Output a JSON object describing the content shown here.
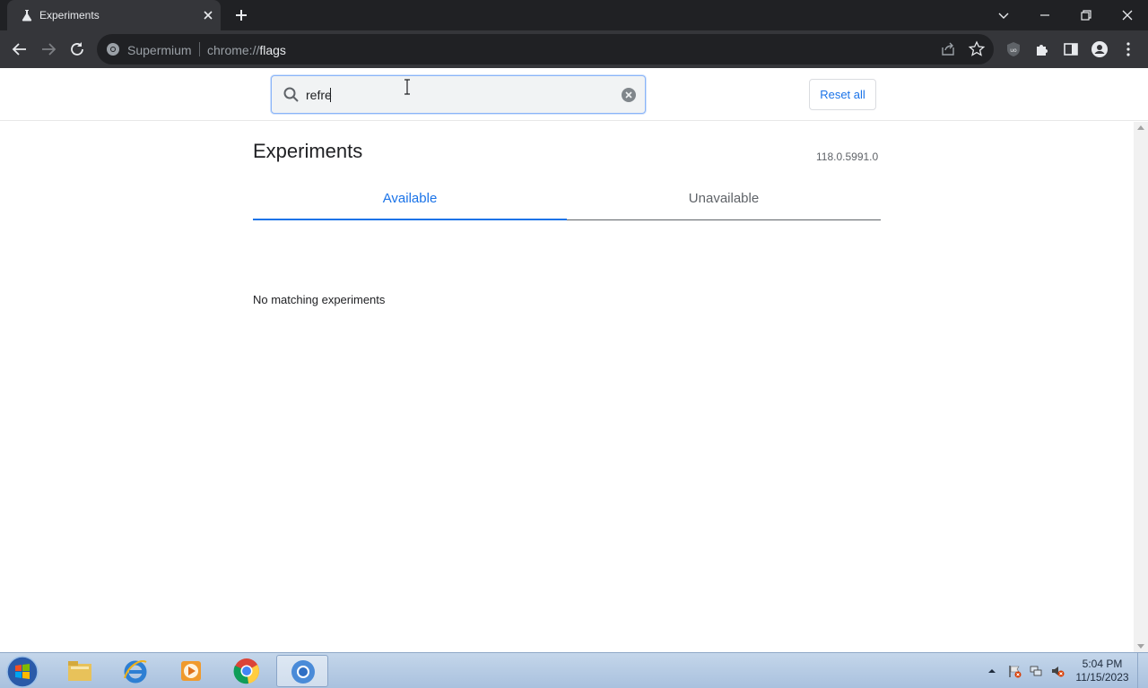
{
  "browser": {
    "tab_title": "Experiments",
    "site_label": "Supermium",
    "url_scheme": "chrome://",
    "url_host": "flags"
  },
  "flags": {
    "search_value": "refre",
    "reset_label": "Reset all",
    "title": "Experiments",
    "version": "118.0.5991.0",
    "tabs": [
      {
        "label": "Available",
        "selected": true
      },
      {
        "label": "Unavailable",
        "selected": false
      }
    ],
    "empty_message": "No matching experiments"
  },
  "taskbar": {
    "apps": [
      "file-explorer",
      "internet-explorer",
      "media-player",
      "chrome",
      "supermium"
    ],
    "clock_time": "5:04 PM",
    "clock_date": "11/15/2023"
  },
  "colors": {
    "accent": "#1a73e8",
    "titlebar": "#202124",
    "toolbar": "#35363a"
  }
}
